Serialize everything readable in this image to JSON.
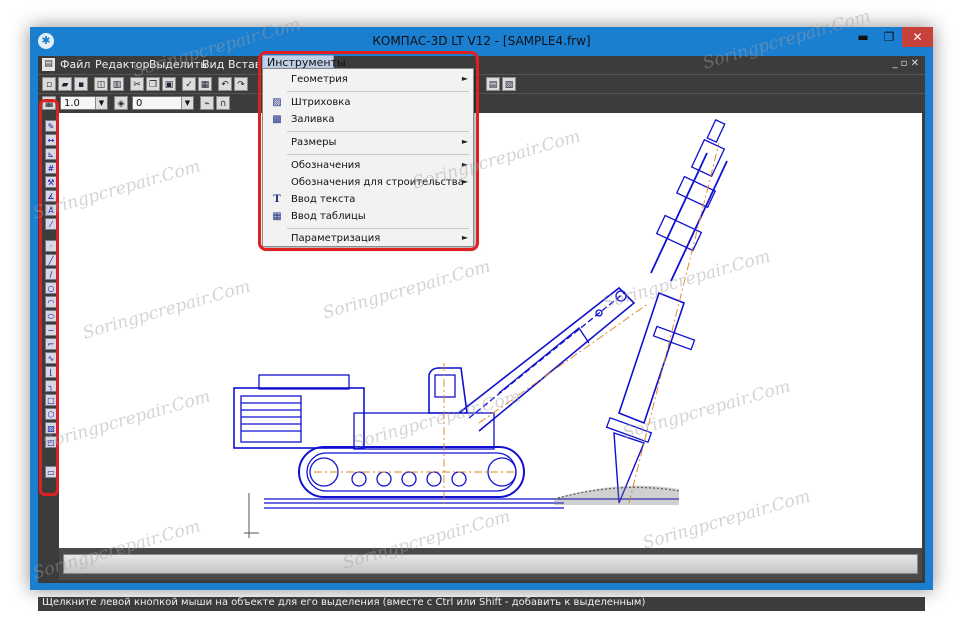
{
  "window": {
    "title": "КОМПАС-3D LT V12 - [SAMPLE4.frw]",
    "minimize": "▬",
    "maximize": "❐",
    "close": "✕"
  },
  "menubar": {
    "items": [
      "Файл",
      "Редактор",
      "Выделить",
      "Вид",
      "Вставка"
    ],
    "open_menu": "Инструменты",
    "mdi_controls": "_ ▫ ✕"
  },
  "toolbar2": {
    "scale_value": "1.0",
    "layer_value": "0"
  },
  "dropdown": {
    "items": [
      {
        "label": "Геометрия",
        "submenu": true,
        "icon": ""
      },
      {
        "label": "Штриховка",
        "submenu": false,
        "icon": "hatch-icon"
      },
      {
        "label": "Заливка",
        "submenu": false,
        "icon": "fill-icon"
      },
      {
        "label": "Размеры",
        "submenu": true,
        "icon": ""
      },
      {
        "label": "Обозначения",
        "submenu": true,
        "icon": ""
      },
      {
        "label": "Обозначения для строительства",
        "submenu": true,
        "icon": ""
      },
      {
        "label": "Ввод текста",
        "submenu": false,
        "icon": "text-input-icon"
      },
      {
        "label": "Ввод таблицы",
        "submenu": false,
        "icon": "table-input-icon"
      },
      {
        "label": "Параметризация",
        "submenu": true,
        "icon": ""
      }
    ]
  },
  "statusbar": {
    "text": "Щелкните левой кнопкой мыши на объекте для его выделения (вместе с Ctrl или Shift - добавить к выделенным)"
  },
  "watermark": "Soringpcrepair.Com",
  "colors": {
    "window_frame": "#1b7fd1",
    "highlight": "#e02020",
    "drawing": "#1010d0",
    "axis": "#e08020"
  }
}
